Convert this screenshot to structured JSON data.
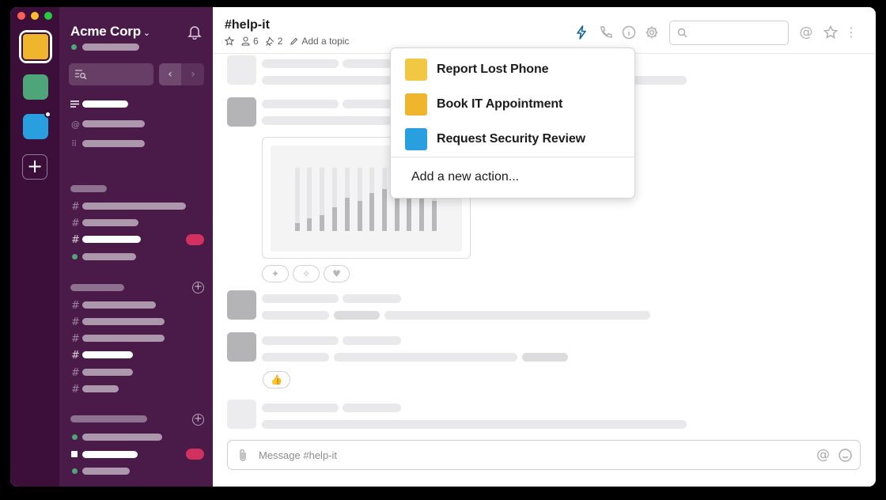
{
  "colors": {
    "rail_bg": "#3b0f3a",
    "sidebar_bg": "#4a1a49",
    "workspace_1": "#efb52c",
    "workspace_2": "#4ea57a",
    "workspace_3": "#2a9fe0",
    "unread_badge": "#d2305f",
    "accent_blue": "#1264a3",
    "traffic_red": "#ff5f57",
    "traffic_yellow": "#febc2e",
    "traffic_green": "#28c840"
  },
  "sidebar": {
    "team_name": "Acme Corp",
    "team_menu_icon": "chevron-down-icon",
    "notifications_icon": "bell-icon"
  },
  "channel": {
    "name": "#help-it",
    "members_count": "6",
    "pinned_count": "2",
    "topic_placeholder": "Add a topic"
  },
  "header_icons": [
    "lightning-icon",
    "phone-icon",
    "info-icon",
    "gear-icon",
    "at-icon",
    "star-icon",
    "more-icon"
  ],
  "workflow_menu": {
    "items": [
      {
        "label": "Report Lost Phone",
        "color": "#f2c744"
      },
      {
        "label": "Book IT Appointment",
        "color": "#efb52c"
      },
      {
        "label": "Request Security Review",
        "color": "#2a9fe0"
      }
    ],
    "add_action_label": "Add a new action..."
  },
  "composer": {
    "placeholder": "Message #help-it"
  },
  "reactions": [
    "party-icon",
    "sparkles-icon",
    "heart-icon"
  ],
  "thumbs_reaction": "thumbs-up-icon"
}
